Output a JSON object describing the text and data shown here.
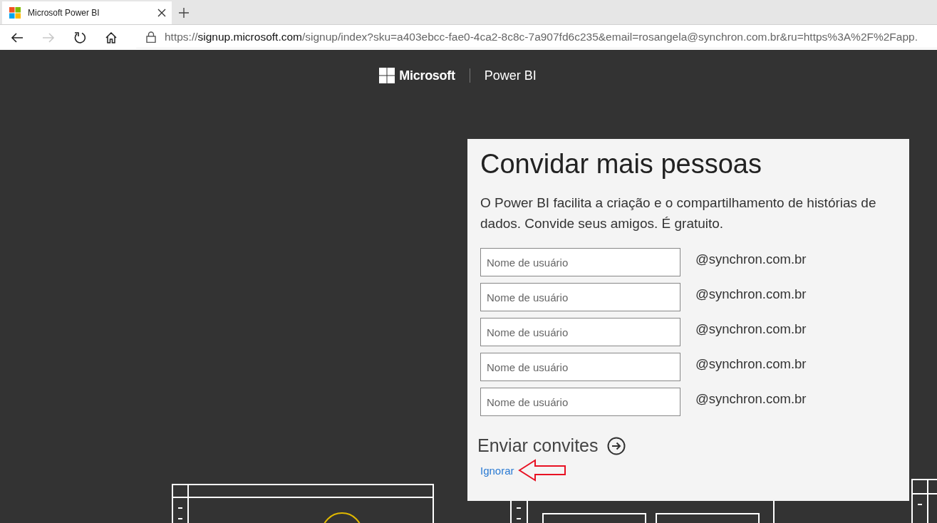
{
  "browser": {
    "tabs": [
      {
        "title": "Microsoft Power BI",
        "selected": true
      }
    ],
    "nav_buttons": [
      {
        "kind": "back",
        "disabled": false
      },
      {
        "kind": "forward",
        "disabled": true
      },
      {
        "kind": "refresh",
        "disabled": false
      },
      {
        "kind": "home",
        "disabled": false
      }
    ],
    "address": {
      "scheme": "https://",
      "host": "signup.microsoft.com",
      "path": "/signup/index?sku=a403ebcc-fae0-4ca2-8c8c-7a907fd6c235&email=rosangela@synchron.com.br&ru=https%3A%2F%2Fapp."
    }
  },
  "header": {
    "brand": "Microsoft",
    "product": "Power BI"
  },
  "card": {
    "title": "Convidar mais pessoas",
    "description": "O Power BI facilita a criação e o compartilhamento de histórias de dados. Convide seus amigos. É gratuito.",
    "invite_fields": [
      {
        "placeholder": "Nome de usuário",
        "suffix": "@synchron.com.br"
      },
      {
        "placeholder": "Nome de usuário",
        "suffix": "@synchron.com.br"
      },
      {
        "placeholder": "Nome de usuário",
        "suffix": "@synchron.com.br"
      },
      {
        "placeholder": "Nome de usuário",
        "suffix": "@synchron.com.br"
      },
      {
        "placeholder": "Nome de usuário",
        "suffix": "@synchron.com.br"
      }
    ],
    "send_button": "Enviar convites",
    "skip_link": "Ignorar"
  }
}
